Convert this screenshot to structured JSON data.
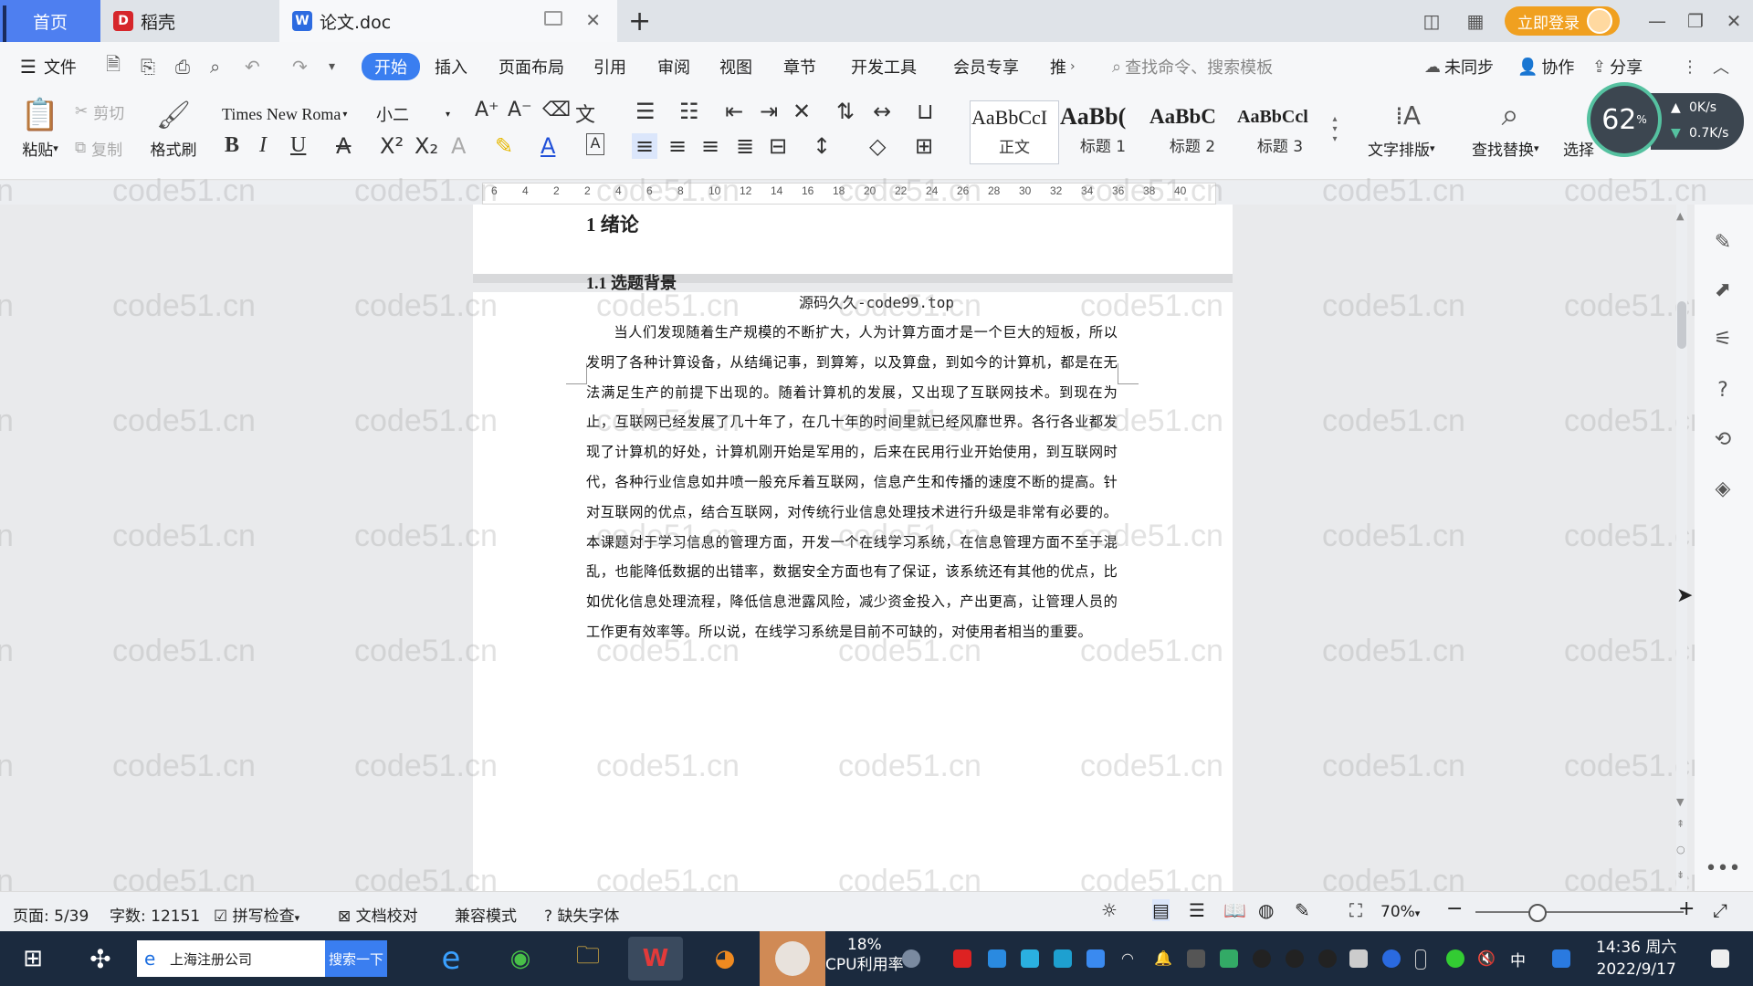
{
  "tabs": {
    "home": "首页",
    "daoke": "稻壳",
    "doc": "论文.doc"
  },
  "title_bar": {
    "login": "立即登录"
  },
  "menu": {
    "file": "文件",
    "items": [
      "开始",
      "插入",
      "页面布局",
      "引用",
      "审阅",
      "视图",
      "章节",
      "开发工具",
      "会员专享",
      "推"
    ],
    "search_cmd": "查找命令、搜索模板",
    "sync": "未同步",
    "collab": "协作",
    "share": "分享"
  },
  "ribbon": {
    "paste": "粘贴",
    "cut": "剪切",
    "copy": "复制",
    "format_painter": "格式刷",
    "font_name": "Times New Roma",
    "font_size": "小二",
    "styles": [
      {
        "sample": "AaBbCcI",
        "name": "正文"
      },
      {
        "sample": "AaBb(",
        "name": "标题 1"
      },
      {
        "sample": "AaBbC",
        "name": "标题 2"
      },
      {
        "sample": "AaBbCcl",
        "name": "标题 3"
      }
    ],
    "text_layout": "文字排版",
    "find_replace": "查找替换",
    "select": "选择"
  },
  "speed_widget": {
    "percent": "62",
    "percent_unit": "%",
    "up": "0K/s",
    "down": "0.7K/s"
  },
  "ruler": [
    "6",
    "4",
    "2",
    "2",
    "4",
    "6",
    "8",
    "10",
    "12",
    "14",
    "16",
    "18",
    "20",
    "22",
    "24",
    "26",
    "28",
    "30",
    "32",
    "34",
    "36",
    "38",
    "40"
  ],
  "document": {
    "heading1": "1  绪论",
    "heading2": "1.1  选题背景",
    "stamp": "源码久久-code99.top",
    "paragraph": "当人们发现随着生产规模的不断扩大，人为计算方面才是一个巨大的短板，所以发明了各种计算设备，从结绳记事，到算筹，以及算盘，到如今的计算机，都是在无法满足生产的前提下出现的。随着计算机的发展，又出现了互联网技术。到现在为止，互联网已经发展了几十年了，在几十年的时间里就已经风靡世界。各行各业都发现了计算机的好处，计算机刚开始是军用的，后来在民用行业开始使用，到互联网时代，各种行业信息如井喷一般充斥着互联网，信息产生和传播的速度不断的提高。针对互联网的优点，结合互联网，对传统行业信息处理技术进行升级是非常有必要的。本课题对于学习信息的管理方面，开发一个在线学习系统，在信息管理方面不至于混乱，也能降低数据的出错率，数据安全方面也有了保证，该系统还有其他的优点，比如优化信息处理流程，降低信息泄露风险，减少资金投入，产出更高，让管理人员的工作更有效率等。所以说，在线学习系统是目前不可缺的，对使用者相当的重要。"
  },
  "watermark": "code51.cn",
  "status": {
    "page": "页面: 5/39",
    "words": "字数: 12151",
    "spell": "拼写检查",
    "proof": "文档校对",
    "compat": "兼容模式",
    "missing_font": "缺失字体",
    "zoom": "70%"
  },
  "taskbar": {
    "search_text": "上海注册公司",
    "search_btn": "搜索一下",
    "cpu_percent": "18%",
    "cpu_label": "CPU利用率",
    "time": "14:36 周六",
    "date": "2022/9/17",
    "ime": "中"
  },
  "colors": {
    "accent": "#3a7ef0",
    "home_tab": "#4e7ff0",
    "login": "#f0a020",
    "taskbar": "#1b2a3e"
  }
}
